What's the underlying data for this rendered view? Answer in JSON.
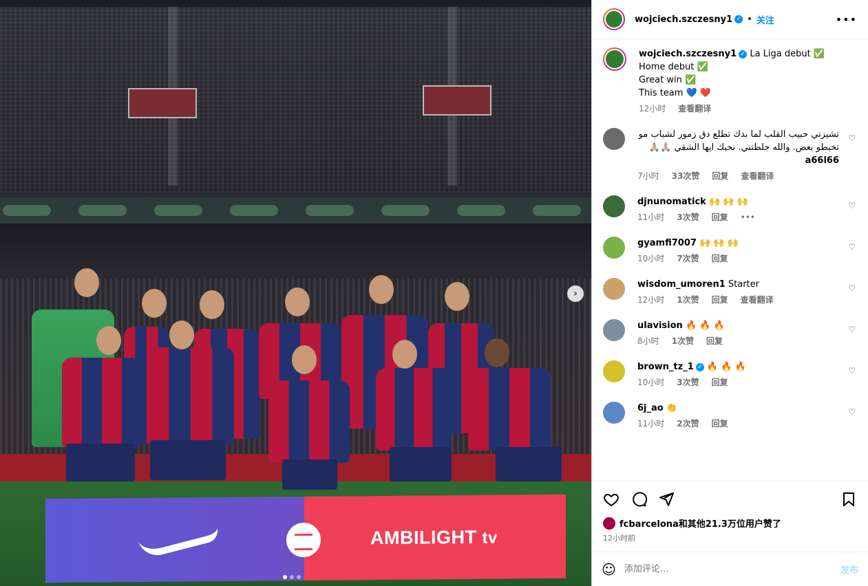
{
  "header": {
    "username": "wojciech.szczesny1",
    "verified": true,
    "separator": "•",
    "follow_label": "关注",
    "more_icon": "more-horizontal-icon"
  },
  "media": {
    "banner_brand_text": "AMBILIGHT",
    "banner_brand_suffix": "tv",
    "next_icon": "chevron-right-icon",
    "slide_count": 3,
    "current_slide": 1
  },
  "caption": {
    "username": "wojciech.szczesny1",
    "lines": [
      "La Liga debut ✅",
      "Home debut ✅",
      "Great win ✅",
      "This team 💙 ❤️"
    ],
    "time": "12小时",
    "translate": "查看翻译"
  },
  "comments": [
    {
      "username": "a66l66",
      "text": "تشيزني حبيب القلب لما بدك تطلع دق زمور لشباب مو تخبطو بعض. والله جلطتني. نحبك ايها الشقي 🙏🏼🙏🏼",
      "time": "7小时",
      "likes": "33次赞",
      "reply": "回复",
      "translate": "查看翻译",
      "rtl": true,
      "avatar_color": "#6b6b6b"
    },
    {
      "username": "djnunomatick",
      "text": "🙌 🙌 🙌",
      "time": "11小时",
      "likes": "3次赞",
      "reply": "回复",
      "options": "•••",
      "avatar_color": "#3a6b3a"
    },
    {
      "username": "gyamfi7007",
      "text": "🙌 🙌 🙌",
      "time": "10小时",
      "likes": "7次赞",
      "reply": "回复",
      "avatar_color": "#7ab24a"
    },
    {
      "username": "wisdom_umoren1",
      "text": "Starter",
      "time": "12小时",
      "likes": "1次赞",
      "reply": "回复",
      "translate": "查看翻译",
      "avatar_color": "#c9a26b"
    },
    {
      "username": "ulavision",
      "text": "🔥 🔥 🔥",
      "time": "8小时",
      "likes": "1次赞",
      "reply": "回复",
      "avatar_color": "#7c8fa1"
    },
    {
      "username": "brown_tz_1",
      "text": "🔥 🔥 🔥",
      "time": "10小时",
      "likes": "3次赞",
      "reply": "回复",
      "verified": true,
      "avatar_color": "#d4c02a"
    },
    {
      "username": "6j_ao",
      "text": "👏",
      "time": "11小时",
      "likes": "2次赞",
      "reply": "回复",
      "avatar_color": "#5a88c4"
    }
  ],
  "likes": {
    "text": "fcbarcelona和其他21.3万位用户赞了",
    "time": "12小时前"
  },
  "add_comment": {
    "placeholder": "添加评论...",
    "post_label": "发布",
    "emoji_icon": "smiley-icon"
  },
  "colors": {
    "accent": "#0095f6",
    "barca_blue": "#23326f",
    "barca_red": "#b8163a"
  }
}
